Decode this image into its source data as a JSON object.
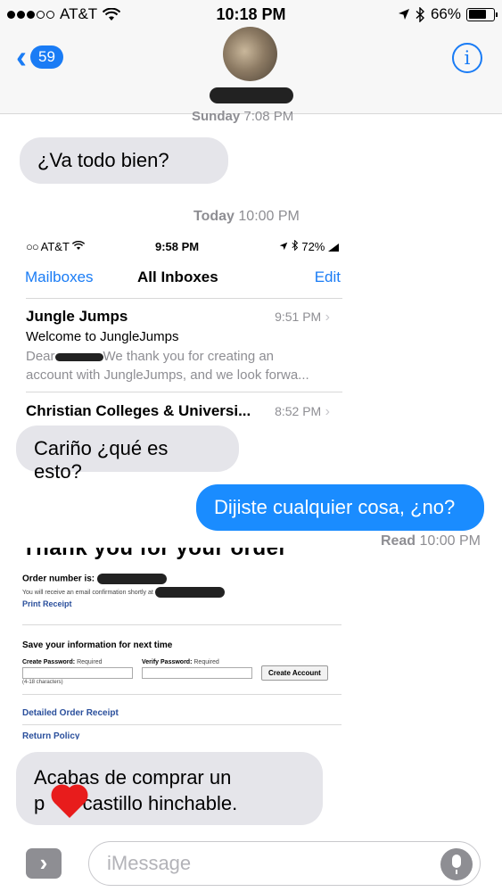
{
  "status_bar": {
    "carrier": "AT&T",
    "time": "10:18 PM",
    "battery": "66%"
  },
  "nav": {
    "back_count": "59"
  },
  "thread": {
    "stamp_top_day": "Sunday",
    "stamp_top_time": "7:08 PM",
    "msg1": "¿Va todo bien?",
    "stamp_today_day": "Today",
    "stamp_today_time": "10:00 PM",
    "msg2": "Cariño ¿qué es esto?",
    "msg3": "Dijiste cualquier cosa, ¿no?",
    "read_label": "Read",
    "read_time": "10:00 PM",
    "msg4_line1": "Acabas de comprar un",
    "msg4_line2_start": "p",
    "msg4_line2_end": "o castillo hinchable."
  },
  "mail_screenshot": {
    "carrier": "AT&T",
    "time": "9:58 PM",
    "battery": "72%",
    "mailboxes": "Mailboxes",
    "title": "All Inboxes",
    "edit": "Edit",
    "email1": {
      "sender": "Jungle Jumps",
      "time": "9:51 PM",
      "subject": "Welcome to JungleJumps",
      "preview_start": "Dear",
      "preview_rest": "We thank you for creating an",
      "preview_line2": "account with JungleJumps, and we look forwa..."
    },
    "email2": {
      "sender": "Christian Colleges & Universi...",
      "time": "8:52 PM"
    }
  },
  "order_screenshot": {
    "heading": "Thank you for your order",
    "order_number_label": "Order number is:",
    "confirmation": "You will receive an email confirmation shortly at",
    "print_receipt": "Print Receipt",
    "save_info": "Save your information for next time",
    "create_password": "Create Password:",
    "verify_password": "Verify Password:",
    "required": "Required",
    "char_hint": "(4-18 characters)",
    "create_account": "Create Account",
    "detailed_receipt": "Detailed Order Receipt",
    "return_policy": "Return Policy"
  },
  "composer": {
    "placeholder": "iMessage"
  },
  "colors": {
    "ios_blue": "#1a7cf5",
    "outgoing_bubble": "#1a8cff",
    "incoming_bubble": "#e5e5ea",
    "heart": "#e81c1c"
  }
}
